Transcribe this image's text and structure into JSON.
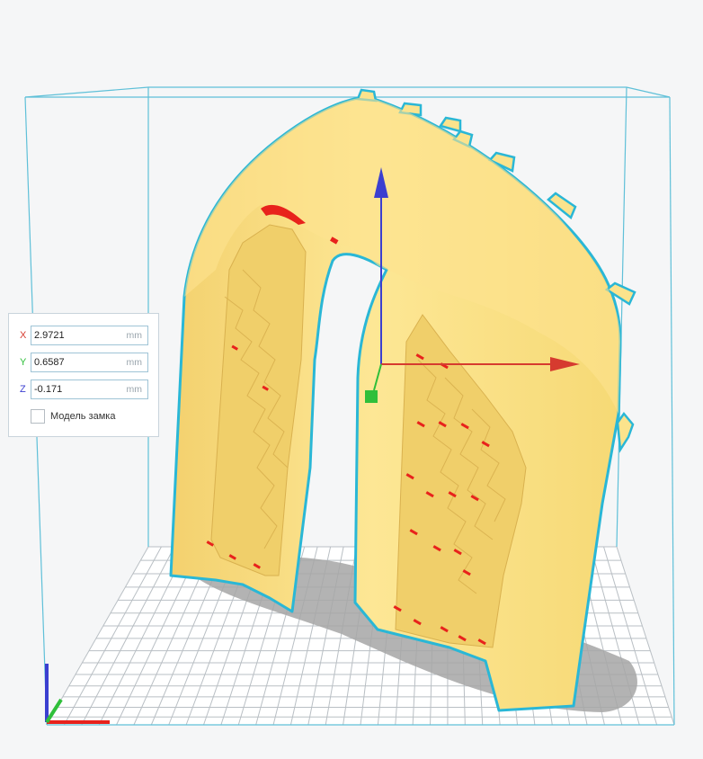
{
  "transform_panel": {
    "x": {
      "axis": "X",
      "value": "2.9721",
      "unit": "mm"
    },
    "y": {
      "axis": "Y",
      "value": "0.6587",
      "unit": "mm"
    },
    "z": {
      "axis": "Z",
      "value": "-0.171",
      "unit": "mm"
    },
    "lock_model_label": "Модель замка",
    "lock_model_checked": false
  },
  "colors": {
    "model": "#fbe38c",
    "model_outline": "#2ab7d6",
    "overhang": "#e8221c",
    "axis_x": "#d63b2f",
    "axis_y": "#2fbf3a",
    "axis_z": "#3b3fd0",
    "build_volume": "#5fc0d8",
    "grid": "#b9bfc4"
  }
}
